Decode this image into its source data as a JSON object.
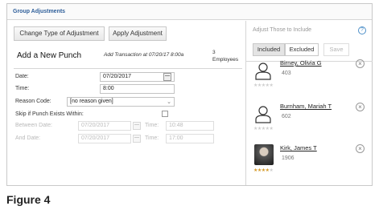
{
  "panel": {
    "title": "Group Adjustments"
  },
  "toolbar": {
    "change_type_label": "Change Type of Adjustment",
    "apply_label": "Apply Adjustment"
  },
  "form": {
    "heading": "Add a New Punch",
    "subheading": "Add Transaction at 07/20/17 8:00a",
    "employee_count": "3",
    "employee_count_label": "Employees",
    "date": {
      "label": "Date:",
      "value": "07/20/2017"
    },
    "time": {
      "label": "Time:",
      "value": "8:00"
    },
    "reason": {
      "label": "Reason Code:",
      "value": "[no reason given]"
    },
    "skip": {
      "label": "Skip if Punch Exists Within:",
      "checked": false
    },
    "between": {
      "label": "Between Date:",
      "date": "07/20/2017",
      "time_label": "Time:",
      "time": "10:48"
    },
    "and": {
      "label": "And Date:",
      "date": "07/20/2017",
      "time_label": "Time:",
      "time": "17:00"
    }
  },
  "right": {
    "title": "Adjust Those to Include",
    "help_icon": "help-icon",
    "tabs": {
      "included": "Included",
      "excluded": "Excluded",
      "save": "Save"
    },
    "employees": [
      {
        "name": "Birney, Olivia G",
        "id": "403",
        "avatar": "person-outline-icon",
        "rating": 0
      },
      {
        "name": "Burnham, Mariah T",
        "id": "602",
        "avatar": "person-outline-icon",
        "rating": 0
      },
      {
        "name": "Kirk, James T",
        "id": "1906",
        "avatar": "photo",
        "rating": 3.5
      }
    ]
  },
  "caption": "Figure 4",
  "colors": {
    "title_blue": "#2f5f9a",
    "help_blue": "#4d8fc8",
    "star_gold": "#d49a2a"
  }
}
